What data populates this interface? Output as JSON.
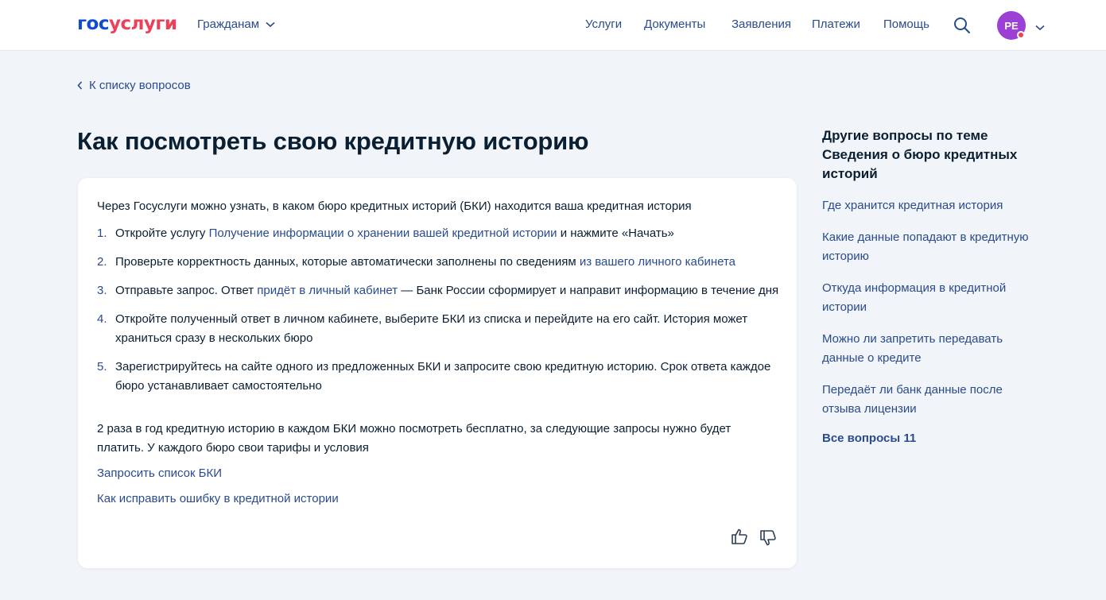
{
  "header": {
    "logo_part1": "гос",
    "logo_part2": "услуги",
    "citizens_label": "Гражданам",
    "nav": [
      "Услуги",
      "Документы",
      "Заявления",
      "Платежи",
      "Помощь"
    ],
    "avatar_initials": "РЕ",
    "colors": {
      "accent": "#0d4cd3",
      "brand_red": "#ee3f58",
      "avatar": "#9c3fd4",
      "link": "#2a4b8d"
    }
  },
  "back_link": "К списку вопросов",
  "title": "Как посмотреть свою кредитную историю",
  "card": {
    "intro": "Через Госуслуги можно узнать, в каком бюро кредитных историй (БКИ) находится ваша кредитная история",
    "steps": [
      {
        "num": "1.",
        "pre": "Откройте услугу ",
        "link": "Получение информации о хранении вашей кредитной истории",
        "post": " и нажмите «Начать»"
      },
      {
        "num": "2.",
        "pre": "Проверьте корректность данных, которые автоматически заполнены по сведениям ",
        "link": "из вашего личного кабинета",
        "post": ""
      },
      {
        "num": "3.",
        "pre": "Отправьте запрос. Ответ ",
        "link": "придёт в личный кабинет",
        "post": " — Банк России сформирует и направит информацию в течение дня"
      },
      {
        "num": "4.",
        "pre": "Откройте полученный ответ в личном кабинете, выберите БКИ из списка и перейдите на его сайт. История может храниться сразу в нескольких бюро",
        "link": "",
        "post": ""
      },
      {
        "num": "5.",
        "pre": "Зарегистрируйтесь на сайте одного из предложенных БКИ и запросите свою кредитную историю. Срок ответа каждое бюро устанавливает самостоятельно",
        "link": "",
        "post": ""
      }
    ],
    "outro": "2 раза в год кредитную историю в каждом БКИ можно посмотреть бесплатно, за следующие запросы нужно будет платить. У каждого бюро свои тарифы и условия",
    "links": [
      "Запросить список БКИ",
      "Как исправить ошибку в кредитной истории"
    ]
  },
  "sidebar": {
    "title": "Другие вопросы по теме Сведения о бюро кредитных историй",
    "items": [
      "Где хранится кредитная история",
      "Какие данные попадают в кредитную историю",
      "Откуда информация в кредитной истории",
      "Можно ли запретить передавать данные о кредите",
      "Передаёт ли банк данные после отзыва лицензии"
    ],
    "all_label": "Все вопросы 11"
  }
}
